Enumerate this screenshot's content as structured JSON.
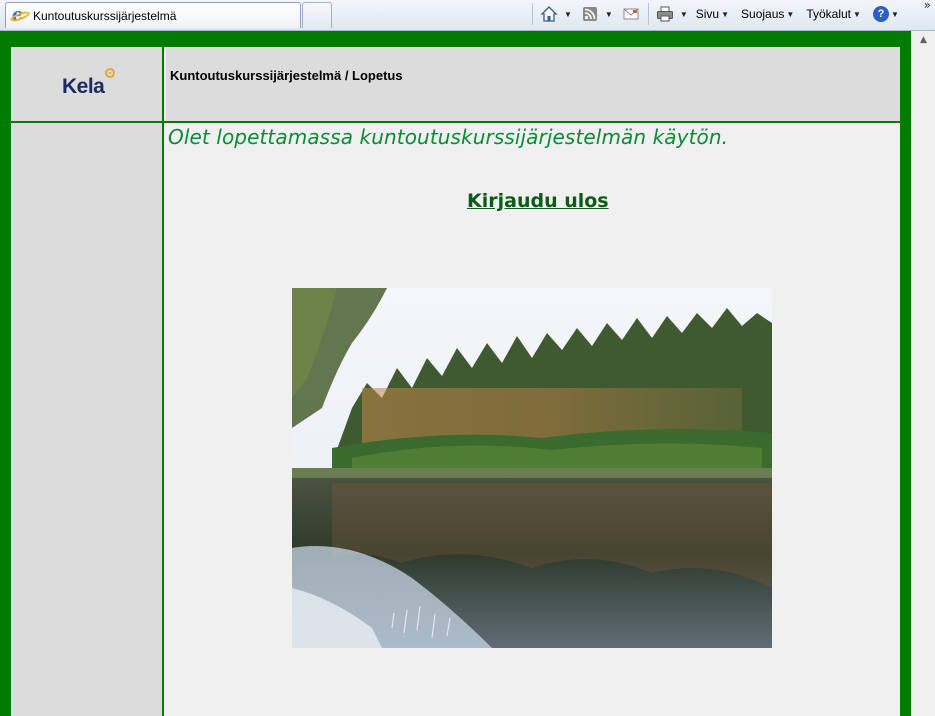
{
  "browser": {
    "tab_title": "Kuntoutuskurssijärjestelmä",
    "menus": {
      "page": "Sivu",
      "safety": "Suojaus",
      "tools": "Työkalut"
    },
    "chevrons": "»"
  },
  "header": {
    "logo_text": "Kela",
    "breadcrumb": "Kuntoutuskurssijärjestelmä / Lopetus"
  },
  "main": {
    "message": "Olet lopettamassa kuntoutuskurssijärjestelmän käytön.",
    "logout_link": "Kirjaudu ulos"
  },
  "colors": {
    "brand_green": "#007c00",
    "message_green": "#0c8a36",
    "link_green": "#0a5c16",
    "panel_gray": "#dcdcdc",
    "kela_navy": "#1a2d6b"
  },
  "icons": [
    "ie-icon",
    "home-icon",
    "rss-feed-icon",
    "mail-icon",
    "print-icon",
    "help-icon"
  ]
}
